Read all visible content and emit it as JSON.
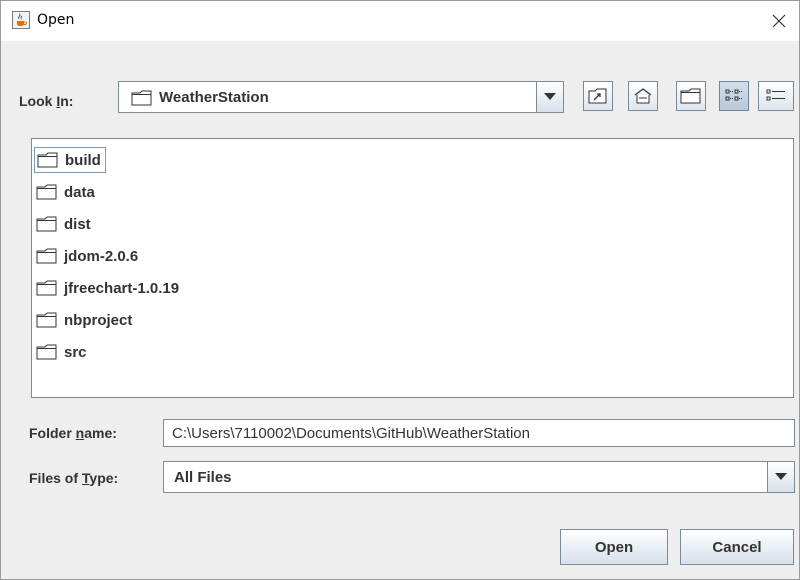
{
  "window": {
    "title": "Open",
    "icon": "java-cup-icon"
  },
  "look_in": {
    "label_prefix": "Look ",
    "label_mnemonic": "I",
    "label_suffix": "n:",
    "value": "WeatherStation"
  },
  "toolbar": {
    "buttons": [
      {
        "name": "up-one-level",
        "icon": "folder-up-icon"
      },
      {
        "name": "home",
        "icon": "home-icon"
      },
      {
        "name": "create-new-folder",
        "icon": "new-folder-icon"
      },
      {
        "name": "list-view",
        "icon": "list-view-icon",
        "selected": true
      },
      {
        "name": "details-view",
        "icon": "details-view-icon",
        "selected": false
      }
    ]
  },
  "files": [
    {
      "name": "build",
      "focused": true
    },
    {
      "name": "data"
    },
    {
      "name": "dist"
    },
    {
      "name": "jdom-2.0.6"
    },
    {
      "name": "jfreechart-1.0.19"
    },
    {
      "name": "nbproject"
    },
    {
      "name": "src"
    }
  ],
  "folder_name": {
    "label_prefix": "Folder ",
    "label_mnemonic": "n",
    "label_suffix": "ame:",
    "value": "C:\\Users\\7110002\\Documents\\GitHub\\WeatherStation"
  },
  "files_of_type": {
    "label_prefix": "Files of ",
    "label_mnemonic": "T",
    "label_suffix": "ype:",
    "value": "All Files"
  },
  "buttons": {
    "open_label": "Open",
    "cancel_label": "Cancel"
  }
}
